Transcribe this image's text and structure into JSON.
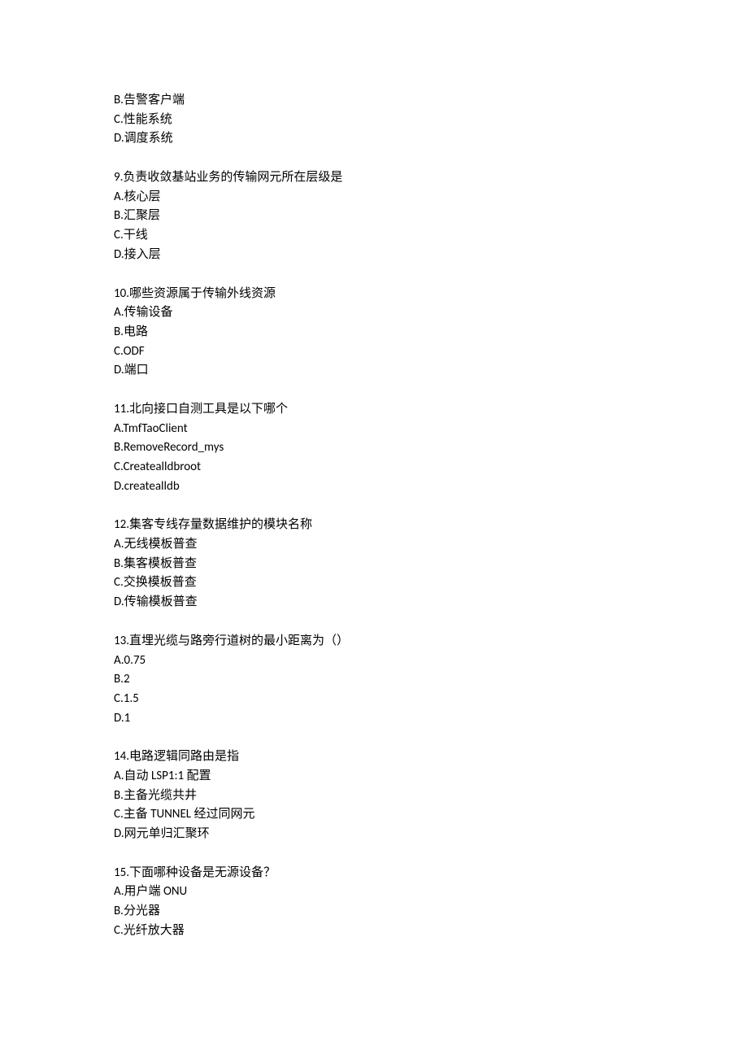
{
  "intro_options": [
    "B.告警客户端",
    "C.性能系统",
    "D.调度系统"
  ],
  "questions": [
    {
      "stem": "9.负责收敛基站业务的传输网元所在层级是",
      "options": [
        "A.核心层",
        "B.汇聚层",
        "C.干线",
        "D.接入层"
      ]
    },
    {
      "stem": "10.哪些资源属于传输外线资源",
      "options": [
        "A.传输设备",
        "B.电路",
        "C.ODF",
        "D.端口"
      ]
    },
    {
      "stem": "11.北向接口自测工具是以下哪个",
      "options": [
        "A.TmfTaoClient",
        "B.RemoveRecord_mys",
        "C.Createalldbroot",
        "D.createalldb"
      ]
    },
    {
      "stem": "12.集客专线存量数据维护的模块名称",
      "options": [
        "A.无线模板普查",
        "B.集客模板普查",
        "C.交换模板普查",
        "D.传输模板普查"
      ]
    },
    {
      "stem": "13.直埋光缆与路旁行道树的最小距离为（）",
      "options": [
        "A.0.75",
        "B.2",
        "C.1.5",
        "D.1"
      ]
    },
    {
      "stem": "14.电路逻辑同路由是指",
      "options": [
        "A.自动 LSP1:1 配置",
        "B.主备光缆共井",
        "C.主备 TUNNEL 经过同网元",
        "D.网元单归汇聚环"
      ]
    },
    {
      "stem": "15.下面哪种设备是无源设备？",
      "options": [
        "A.用户端 ONU",
        "B.分光器",
        "C.光纤放大器"
      ]
    }
  ]
}
